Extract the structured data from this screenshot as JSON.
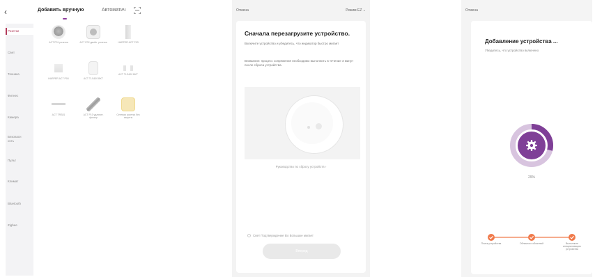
{
  "screen1": {
    "tabs": {
      "manual": "Добавить вручную",
      "auto": "Автоматич"
    },
    "sidebar": [
      {
        "label": "Розетки"
      },
      {
        "label": "Свет"
      },
      {
        "label": "Техника"
      },
      {
        "label": "Фитнес"
      },
      {
        "label": "Камера"
      },
      {
        "label": "Безопасн ость"
      },
      {
        "label": "Пульт"
      },
      {
        "label": "Климат"
      },
      {
        "label": "Bluetooth"
      },
      {
        "label": "Zigbee"
      }
    ],
    "grid": [
      {
        "label": "ACT P01 розетка"
      },
      {
        "label": "ACT P02 двойн. розетка"
      },
      {
        "label": "HARPER ACT P03"
      },
      {
        "label": "HARPER ACT P04"
      },
      {
        "label": "ACT TLS400 BKT"
      },
      {
        "label": "ACT TLS400 BKT"
      },
      {
        "label": "ACT TRS81"
      },
      {
        "label": "ACT P10 удлинит. фильтр"
      },
      {
        "label": "Сетевая розетка без защиты"
      }
    ]
  },
  "screen2": {
    "cancel": "Отмена",
    "mode": "Режим EZ",
    "title": "Сначала перезагрузите устройство.",
    "desc": "Включите устройство и убедитесь, что индикатор быстро мигает",
    "warning": "Внимание: процесс сопряжения необходимо выполнить в течение 3 минут после сброса устройства.",
    "guide": "Руководство по сбросу устройств",
    "confirm": "Свет Подтверждение Во Вспышке мигает",
    "next": "Вперед"
  },
  "screen3": {
    "cancel": "Отмена",
    "title": "Добавление устройства ...",
    "subtitle": "Убедитесь, что устройство включено",
    "progress": 0.29,
    "progress_label": "29%",
    "steps": [
      {
        "label": "Поиск устройства"
      },
      {
        "label": "Облачного облачный"
      },
      {
        "label": "Выполните инициализацию устройства"
      }
    ]
  },
  "colors": {
    "accent_purple": "#7f3f97",
    "step_orange": "#f07a4b",
    "tab_underline": "#8e3b9c",
    "sidebar_active": "#b23a5a"
  }
}
